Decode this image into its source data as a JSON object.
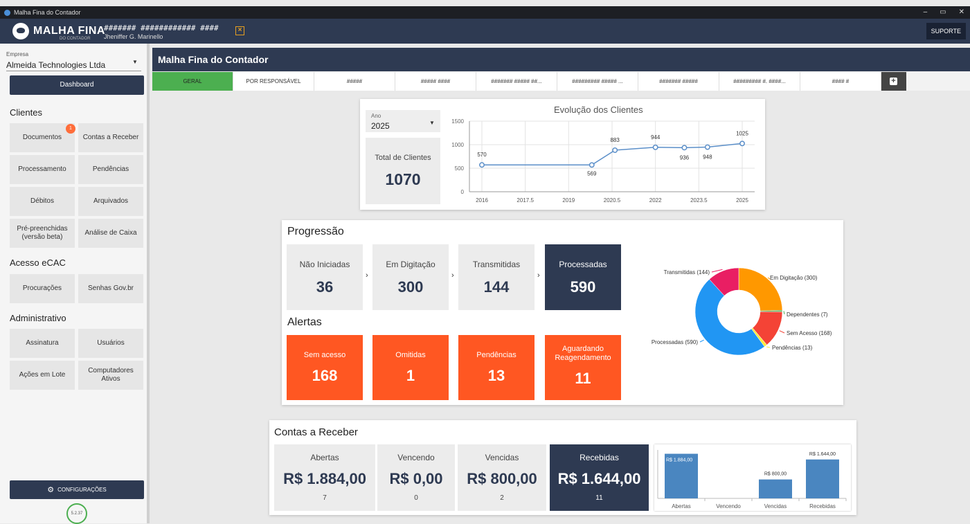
{
  "window": {
    "title": "Malha Fina do Contador",
    "controls": [
      "–",
      "▭",
      "✕"
    ]
  },
  "topbar": {
    "brand": "MALHA FINA",
    "brand_sub": "DO CONTADOR",
    "company_code": "####### ############ ####",
    "user": "Jheniffer G. Marinello",
    "support_label": "SUPORTE"
  },
  "sidebar": {
    "empresa_label": "Empresa",
    "empresa_value": "Almeida Technologies Ltda",
    "dashboard_label": "Dashboard",
    "clientes_title": "Clientes",
    "acesso_title": "Acesso eCAC",
    "admin_title": "Administrativo",
    "items": {
      "documentos": "Documentos",
      "documentos_badge": "1",
      "contas_receber": "Contas a Receber",
      "processamento": "Processamento",
      "pendencias": "Pendências",
      "debitos": "Débitos",
      "arquivados": "Arquivados",
      "pre_preenchidas": "Pré-preenchidas (versão beta)",
      "analise_caixa": "Análise de Caixa",
      "procuracoes": "Procurações",
      "senhas": "Senhas Gov.br",
      "assinatura": "Assinatura",
      "usuarios": "Usuários",
      "acoes_lote": "Ações em Lote",
      "computadores": "Computadores Ativos"
    },
    "config_label": "CONFIGURAÇÕES",
    "version": "5.2.37"
  },
  "main": {
    "title": "Malha Fina do Contador",
    "tabs": [
      "GERAL",
      "POR RESPONSÁVEL",
      "#####",
      "##### ####",
      "####### ##### ##...",
      "######### ##### ...",
      "####### #####",
      "######### #. ####...",
      "#### #"
    ]
  },
  "clientes": {
    "ano_label": "Ano",
    "ano_value": "2025",
    "total_label": "Total de Clientes",
    "total_value": "1070"
  },
  "chart_data": [
    {
      "type": "line",
      "title": "Evolução dos Clientes",
      "x": [
        2016,
        2019.8,
        2020.6,
        2022,
        2023,
        2023.8,
        2025
      ],
      "y": [
        570,
        569,
        883,
        944,
        936,
        948,
        1025
      ],
      "data_labels": [
        "570",
        "569",
        "883",
        "944",
        "936",
        "948",
        "1025"
      ],
      "xticks": [
        "2016",
        "2017.5",
        "2019",
        "2020.5",
        "2022",
        "2023.5",
        "2025"
      ],
      "yticks": [
        "0",
        "500",
        "1000",
        "1500"
      ],
      "xlim": [
        2016,
        2025
      ],
      "ylim": [
        0,
        1500
      ],
      "grid": true,
      "color": "#5b8fc9"
    },
    {
      "type": "pie",
      "series": [
        {
          "name": "Em Digitação (300)",
          "value": 300,
          "color": "#ff9800"
        },
        {
          "name": "Dependentes (7)",
          "value": 7,
          "color": "#4caf50"
        },
        {
          "name": "Sem Acesso (168)",
          "value": 168,
          "color": "#f44336"
        },
        {
          "name": "Pendências (13)",
          "value": 13,
          "color": "#ffeb3b"
        },
        {
          "name": "Processadas (590)",
          "value": 590,
          "color": "#2196f3"
        },
        {
          "name": "Transmitidas (144)",
          "value": 144,
          "color": "#e91e63"
        }
      ]
    },
    {
      "type": "bar",
      "categories": [
        "Abertas",
        "Vencendo",
        "Vencidas",
        "Recebidas"
      ],
      "values": [
        1884,
        0,
        800,
        1644
      ],
      "data_labels": [
        "R$ 1.884,00",
        "",
        "R$ 800,00",
        "R$ 1.644,00"
      ],
      "ylim": [
        0,
        1900
      ],
      "color": "#4a86c0"
    }
  ],
  "progressao": {
    "title": "Progressão",
    "cards": [
      {
        "label": "Não Iniciadas",
        "value": "36"
      },
      {
        "label": "Em Digitação",
        "value": "300"
      },
      {
        "label": "Transmitidas",
        "value": "144"
      },
      {
        "label": "Processadas",
        "value": "590"
      }
    ],
    "arrow": "›"
  },
  "alertas": {
    "title": "Alertas",
    "cards": [
      {
        "label": "Sem acesso",
        "value": "168"
      },
      {
        "label": "Omitidas",
        "value": "1"
      },
      {
        "label": "Pendências",
        "value": "13"
      },
      {
        "label": "Aguardando Reagendamento",
        "value": "11"
      }
    ]
  },
  "contas": {
    "title": "Contas a Receber",
    "cards": [
      {
        "label": "Abertas",
        "value": "R$ 1.884,00",
        "count": "7"
      },
      {
        "label": "Vencendo",
        "value": "R$ 0,00",
        "count": "0"
      },
      {
        "label": "Vencidas",
        "value": "R$ 800,00",
        "count": "2"
      },
      {
        "label": "Recebidas",
        "value": "R$ 1.644,00",
        "count": "11"
      }
    ]
  }
}
